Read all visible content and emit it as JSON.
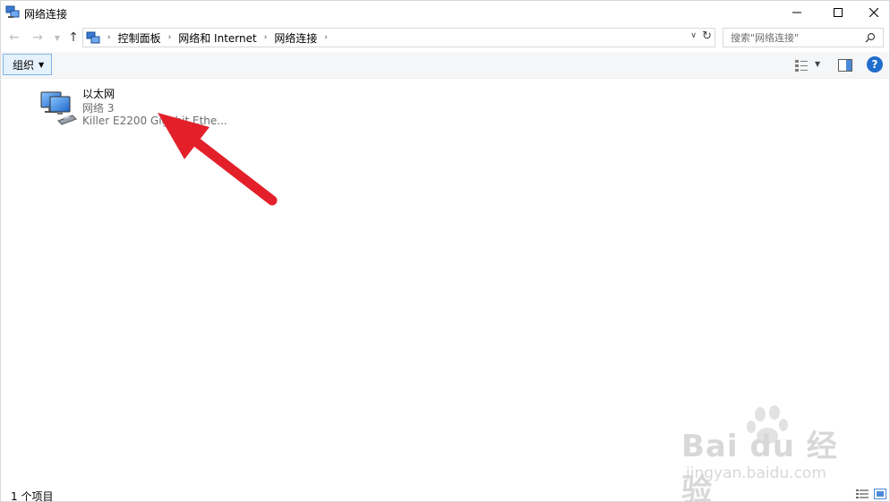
{
  "window": {
    "title": "网络连接"
  },
  "address": {
    "crumbs": [
      "控制面板",
      "网络和 Internet",
      "网络连接"
    ]
  },
  "search": {
    "placeholder": "搜索\"网络连接\""
  },
  "toolbar": {
    "organize_label": "组织"
  },
  "connection": {
    "name": "以太网",
    "network": "网络 3",
    "device": "Killer E2200 Gigabit Ethe..."
  },
  "status": {
    "item_count": "1 个项目"
  },
  "watermark": {
    "brand": "Bai du 经验",
    "url": "jingyan.baidu.com"
  },
  "colors": {
    "accent": "#1f6dcc",
    "selection_border": "#7eb4ea",
    "annotation_arrow": "#e3202a"
  }
}
